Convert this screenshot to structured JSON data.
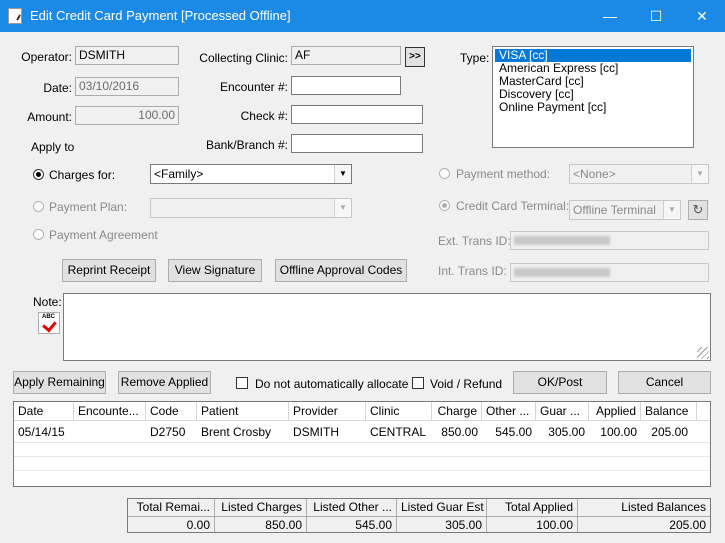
{
  "window": {
    "title": "Edit Credit Card Payment [Processed Offline]",
    "minimize": "—",
    "maximize": "☐",
    "close": "✕"
  },
  "form": {
    "operator_label": "Operator:",
    "operator_value": "DSMITH",
    "date_label": "Date:",
    "date_value": "03/10/2016",
    "amount_label": "Amount:",
    "amount_value": "100.00",
    "apply_to_label": "Apply to",
    "collecting_clinic_label": "Collecting Clinic:",
    "collecting_clinic_value": "AF",
    "encounter_label": "Encounter #:",
    "encounter_value": "",
    "check_label": "Check #:",
    "check_value": "",
    "bank_label": "Bank/Branch #:",
    "bank_value": "",
    "type_label": "Type:",
    "type_options": [
      "VISA [cc]",
      "American Express [cc]",
      "MasterCard [cc]",
      "Discovery [cc]",
      "Online Payment [cc]"
    ],
    "charges_for_label": "Charges for:",
    "charges_for_value": "<Family>",
    "payment_plan_label": "Payment Plan:",
    "payment_plan_value": "",
    "payment_agreement_label": "Payment Agreement",
    "payment_method_label": "Payment method:",
    "payment_method_value": "<None>",
    "cc_terminal_label": "Credit Card Terminal:",
    "cc_terminal_value": "Offline Terminal",
    "ext_trans_label": "Ext. Trans ID:",
    "int_trans_label": "Int. Trans ID:",
    "note_label": "Note:",
    "note_value": ""
  },
  "buttons": {
    "reprint_receipt": "Reprint Receipt",
    "view_signature": "View Signature",
    "offline_approval": "Offline Approval Codes",
    "apply_remaining": "Apply Remaining",
    "remove_applied": "Remove Applied",
    "do_not_allocate": "Do not automatically allocate",
    "void_refund": "Void / Refund",
    "ok_post": "OK/Post",
    "cancel": "Cancel",
    "spell_check_glyph": "ABC"
  },
  "grid": {
    "columns": [
      "Date",
      "Encounte...",
      "Code",
      "Patient",
      "Provider",
      "Clinic",
      "Charge",
      "Other ...",
      "Guar ...",
      "Applied",
      "Balance"
    ],
    "rows": [
      [
        "05/14/15",
        "",
        "D2750",
        "Brent Crosby",
        "DSMITH",
        "CENTRAL",
        "850.00",
        "545.00",
        "305.00",
        "100.00",
        "205.00"
      ]
    ]
  },
  "totals": {
    "headers": [
      "Total Remai...",
      "Listed Charges",
      "Listed Other ...",
      "Listed Guar Est",
      "Total Applied",
      "Listed Balances"
    ],
    "values": [
      "0.00",
      "850.00",
      "545.00",
      "305.00",
      "100.00",
      "205.00"
    ]
  },
  "colors": {
    "titlebar": "#1a8ae6",
    "selection": "#0078d7",
    "background": "#f0f0f0"
  }
}
